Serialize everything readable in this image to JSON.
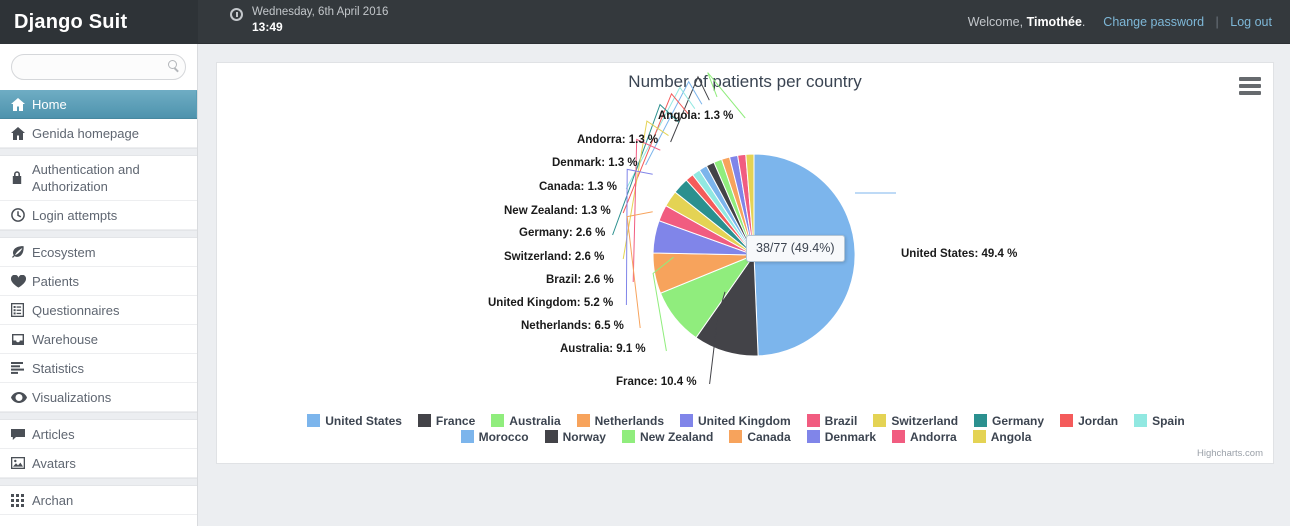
{
  "header": {
    "brand": "Django Suit",
    "clock_icon": "clock-icon",
    "date": "Wednesday, 6th April 2016",
    "time": "13:49",
    "welcome_prefix": "Welcome,",
    "username": "Timothée",
    "welcome_suffix": ".",
    "change_password": "Change password",
    "separator": "|",
    "logout": "Log out"
  },
  "sidebar": {
    "search_placeholder": "",
    "search_value": "",
    "search_icon": "search-icon",
    "items": [
      {
        "label": "Home",
        "icon": "home-icon",
        "active": true,
        "gap_before": false
      },
      {
        "label": "Genida homepage",
        "icon": "home-icon",
        "active": false,
        "gap_before": false
      },
      {
        "label": "Authentication and Authorization",
        "icon": "lock-icon",
        "active": false,
        "gap_before": true
      },
      {
        "label": "Login attempts",
        "icon": "clock-icon",
        "active": false,
        "gap_before": false
      },
      {
        "label": "Ecosystem",
        "icon": "leaf-icon",
        "active": false,
        "gap_before": true
      },
      {
        "label": "Patients",
        "icon": "heart-icon",
        "active": false,
        "gap_before": false
      },
      {
        "label": "Questionnaires",
        "icon": "list-icon",
        "active": false,
        "gap_before": false
      },
      {
        "label": "Warehouse",
        "icon": "inbox-icon",
        "active": false,
        "gap_before": false
      },
      {
        "label": "Statistics",
        "icon": "bars-icon",
        "active": false,
        "gap_before": false
      },
      {
        "label": "Visualizations",
        "icon": "eye-icon",
        "active": false,
        "gap_before": false
      },
      {
        "label": "Articles",
        "icon": "comment-icon",
        "active": false,
        "gap_before": true
      },
      {
        "label": "Avatars",
        "icon": "image-icon",
        "active": false,
        "gap_before": false
      },
      {
        "label": "Archan",
        "icon": "grid-icon",
        "active": false,
        "gap_before": true
      }
    ]
  },
  "panel": {
    "export_menu_icon": "hamburger-icon",
    "credits": "Highcharts.com",
    "tooltip": "38/77 (49.4%)"
  },
  "chart_data": {
    "type": "pie",
    "title": "Number of patients per country",
    "total": 77,
    "legend_position": "bottom",
    "labels": [
      {
        "name": "United States",
        "pct": 49.4,
        "count": 38,
        "text": "United States: 49.4 %",
        "color": "#7cb5ec"
      },
      {
        "name": "France",
        "pct": 10.4,
        "count": 8,
        "text": "France: 10.4 %",
        "color": "#434348"
      },
      {
        "name": "Australia",
        "pct": 9.1,
        "count": 7,
        "text": "Australia: 9.1 %",
        "color": "#90ed7d"
      },
      {
        "name": "Netherlands",
        "pct": 6.5,
        "count": 5,
        "text": "Netherlands: 6.5 %",
        "color": "#f7a35c"
      },
      {
        "name": "United Kingdom",
        "pct": 5.2,
        "count": 4,
        "text": "United Kingdom: 5.2 %",
        "color": "#8085e9"
      },
      {
        "name": "Brazil",
        "pct": 2.6,
        "count": 2,
        "text": "Brazil: 2.6 %",
        "color": "#f15c80"
      },
      {
        "name": "Switzerland",
        "pct": 2.6,
        "count": 2,
        "text": "Switzerland: 2.6 %",
        "color": "#e4d354"
      },
      {
        "name": "Germany",
        "pct": 2.6,
        "count": 2,
        "text": "Germany: 2.6 %",
        "color": "#2b908f"
      },
      {
        "name": "New Zealand",
        "pct": 1.3,
        "count": 1,
        "text": "New Zealand: 1.3 %",
        "color": "#f45b5b"
      },
      {
        "name": "Canada",
        "pct": 1.3,
        "count": 1,
        "text": "Canada: 1.3 %",
        "color": "#91e8e1"
      },
      {
        "name": "Denmark",
        "pct": 1.3,
        "count": 1,
        "text": "Denmark: 1.3 %",
        "color": "#7cb5ec"
      },
      {
        "name": "Andorra",
        "pct": 1.3,
        "count": 1,
        "text": "Andorra: 1.3 %",
        "color": "#434348"
      },
      {
        "name": "Angola",
        "pct": 1.3,
        "count": 1,
        "text": "Angola: 1.3 %",
        "color": "#90ed7d"
      },
      {
        "name": "Morocco",
        "pct": 1.3,
        "count": 1,
        "text": "",
        "color": "#f7a35c"
      },
      {
        "name": "Norway",
        "pct": 1.3,
        "count": 1,
        "text": "",
        "color": "#8085e9"
      },
      {
        "name": "Jordan",
        "pct": 1.3,
        "count": 1,
        "text": "",
        "color": "#f15c80"
      },
      {
        "name": "Spain",
        "pct": 1.3,
        "count": 1,
        "text": "",
        "color": "#e4d354"
      }
    ],
    "legend": [
      {
        "label": "United States",
        "color": "#7cb5ec"
      },
      {
        "label": "France",
        "color": "#434348"
      },
      {
        "label": "Australia",
        "color": "#90ed7d"
      },
      {
        "label": "Netherlands",
        "color": "#f7a35c"
      },
      {
        "label": "United Kingdom",
        "color": "#8085e9"
      },
      {
        "label": "Brazil",
        "color": "#f15c80"
      },
      {
        "label": "Switzerland",
        "color": "#e4d354"
      },
      {
        "label": "Germany",
        "color": "#2b908f"
      },
      {
        "label": "Jordan",
        "color": "#f45b5b"
      },
      {
        "label": "Spain",
        "color": "#91e8e1"
      },
      {
        "label": "Morocco",
        "color": "#7cb5ec"
      },
      {
        "label": "Norway",
        "color": "#434348"
      },
      {
        "label": "New Zealand",
        "color": "#90ed7d"
      },
      {
        "label": "Canada",
        "color": "#f7a35c"
      },
      {
        "label": "Denmark",
        "color": "#8085e9"
      },
      {
        "label": "Andorra",
        "color": "#f15c80"
      },
      {
        "label": "Angola",
        "color": "#e4d354"
      }
    ]
  }
}
